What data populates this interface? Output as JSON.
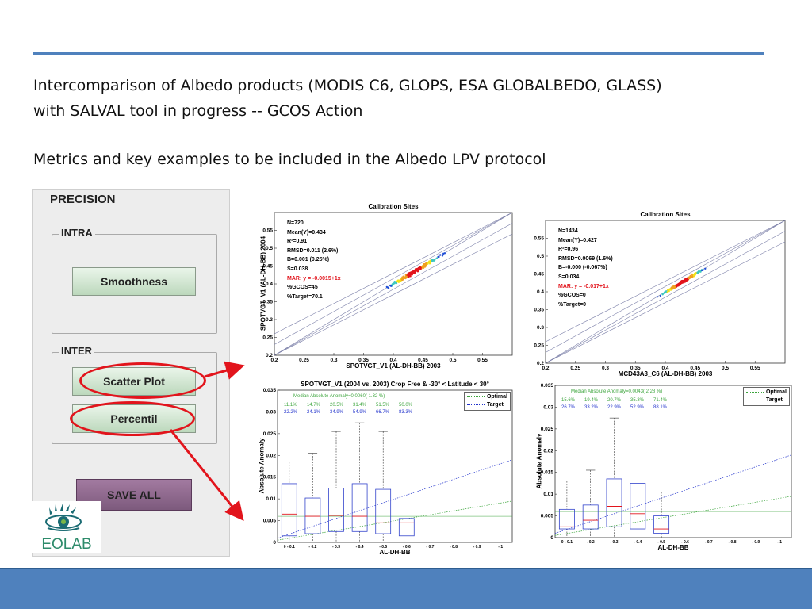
{
  "slide": {
    "line1": "Intercomparison of Albedo products (MODIS C6, GLOPS, ESA GLOBALBEDO, GLASS)",
    "line2": "with SALVAL tool in progress   --  GCOS Action",
    "line3": "Metrics and key examples  to be  included in the Albedo LPV protocol"
  },
  "panel": {
    "title": "PRECISION",
    "intra_label": "INTRA",
    "smoothness": "Smoothness",
    "inter_label": "INTER",
    "scatter_plot": "Scatter Plot",
    "percentil": "Percentil",
    "save_all": "SAVE ALL"
  },
  "logo": {
    "text": "EOLAB"
  },
  "colors": {
    "accent": "#4f81bd",
    "arrow": "#e2141c",
    "mar": "#e2141c"
  },
  "chart_data": [
    {
      "type": "scatter",
      "title": "Calibration Sites",
      "xlabel": "SPOTVGT_V1 (AL-DH-BB) 2003",
      "ylabel": "SPOTVGT_V1 (AL-DH-BB) 2004",
      "xlim": [
        0.2,
        0.6
      ],
      "ylim": [
        0.2,
        0.6
      ],
      "xticks": [
        "0.2",
        "0.25",
        "0.3",
        "0.35",
        "0.4",
        "0.45",
        "0.5",
        "0.55"
      ],
      "yticks": [
        "0.2",
        "0.25",
        "0.3",
        "0.35",
        "0.4",
        "0.45",
        "0.5",
        "0.55"
      ],
      "stats": [
        "N=720",
        "Mean(Y)=0.434",
        "R²=0.91",
        "RMSD=0.011 (2.6%)",
        "B=0.001 (0.25%)",
        "S=0.038",
        "MAR: y = -0.0015+1x",
        "%GCOS=45",
        "%Target=70.1"
      ],
      "mar_index": 6,
      "cluster": {
        "center": [
          0.435,
          0.434
        ],
        "spread": 0.035,
        "n": 720
      }
    },
    {
      "type": "scatter",
      "title": "Calibration Sites",
      "xlabel": "MCD43A3_C6 (AL-DH-BB) 2003",
      "ylabel": "",
      "xlim": [
        0.2,
        0.6
      ],
      "ylim": [
        0.2,
        0.6
      ],
      "xticks": [
        "0.2",
        "0.25",
        "0.3",
        "0.35",
        "0.4",
        "0.45",
        "0.5",
        "0.55"
      ],
      "yticks": [
        "0.2",
        "0.25",
        "0.3",
        "0.35",
        "0.4",
        "0.45",
        "0.5",
        "0.55"
      ],
      "stats": [
        "N=1434",
        "Mean(Y)=0.427",
        "R²=0.96",
        "RMSD=0.0069 (1.6%)",
        "B=-0.000 (-0.067%)",
        "S=0.034",
        "MAR: y = -0.017+1x",
        "%GCOS=0",
        "%Target=0"
      ],
      "mar_index": 6,
      "cluster": {
        "center": [
          0.428,
          0.427
        ],
        "spread": 0.03,
        "n": 1434
      }
    },
    {
      "type": "box",
      "title": "SPOTVGT_V1 (2004 vs. 2003)  Crop Free & -30° < Latitude < 30°",
      "xlabel": "AL-DH-BB",
      "ylabel": "Absolute Anomaly",
      "ylim": [
        0,
        0.035
      ],
      "yticks": [
        "0",
        "0.005",
        "0.01",
        "0.015",
        "0.02",
        "0.025",
        "0.03",
        "0.035"
      ],
      "xticks": [
        "0 - 0.1",
        "- 0.2",
        "- 0.3",
        "- 0.4",
        "- 0.5",
        "- 0.6",
        "- 0.7",
        "- 0.8",
        "- 0.9",
        "- 1"
      ],
      "legend": [
        "Optimal",
        "Target"
      ],
      "median_label": "Median Absolute Anomaly=0.0060( 1.32 %)",
      "green_row": [
        "11.1%",
        "14.7%",
        "20.5%",
        "31.4%",
        "51.5%",
        "50.0%"
      ],
      "blue_row": [
        "22.2%",
        "24.1%",
        "34.9%",
        "54.9%",
        "66.7%",
        "83.3%"
      ],
      "boxes": [
        {
          "q1": 0.0015,
          "med": 0.0065,
          "q3": 0.0135,
          "wlo": 0,
          "whi": 0.0185
        },
        {
          "q1": 0.002,
          "med": 0.006,
          "q3": 0.0102,
          "wlo": 0,
          "whi": 0.0205
        },
        {
          "q1": 0.0025,
          "med": 0.0062,
          "q3": 0.0125,
          "wlo": 0,
          "whi": 0.0255
        },
        {
          "q1": 0.0025,
          "med": 0.006,
          "q3": 0.0135,
          "wlo": 0,
          "whi": 0.0275
        },
        {
          "q1": 0.002,
          "med": 0.0045,
          "q3": 0.0122,
          "wlo": 0,
          "whi": 0.0255
        },
        {
          "q1": 0.0015,
          "med": 0.0045,
          "q3": 0.0055,
          "wlo": 0.0015,
          "whi": 0.0055
        }
      ]
    },
    {
      "type": "box",
      "title": "",
      "xlabel": "AL-DH-BB",
      "ylabel": "Absolute Anomaly",
      "ylim": [
        0,
        0.035
      ],
      "yticks": [
        "0",
        "0.005",
        "0.01",
        "0.015",
        "0.02",
        "0.025",
        "0.03",
        "0.035"
      ],
      "xticks": [
        "0 - 0.1",
        "- 0.2",
        "- 0.3",
        "- 0.4",
        "- 0.5",
        "- 0.6",
        "- 0.7",
        "- 0.8",
        "- 0.9",
        "- 1"
      ],
      "legend": [
        "Optimal",
        "Target"
      ],
      "median_label": "Median Absolute Anomaly=0.0043( 2.28 %)",
      "green_row": [
        "15.6%",
        "19.4%",
        "20.7%",
        "35.3%",
        "71.4%"
      ],
      "blue_row": [
        "26.7%",
        "33.2%",
        "22.9%",
        "52.9%",
        "88.1%"
      ],
      "boxes": [
        {
          "q1": 0.002,
          "med": 0.0025,
          "q3": 0.0065,
          "wlo": 0,
          "whi": 0.013
        },
        {
          "q1": 0.002,
          "med": 0.004,
          "q3": 0.0075,
          "wlo": 0,
          "whi": 0.0155
        },
        {
          "q1": 0.0025,
          "med": 0.0072,
          "q3": 0.0135,
          "wlo": 0,
          "whi": 0.0275
        },
        {
          "q1": 0.002,
          "med": 0.0055,
          "q3": 0.0125,
          "wlo": 0,
          "whi": 0.0245
        },
        {
          "q1": 0.001,
          "med": 0.002,
          "q3": 0.005,
          "wlo": 0,
          "whi": 0.0105
        }
      ]
    }
  ]
}
